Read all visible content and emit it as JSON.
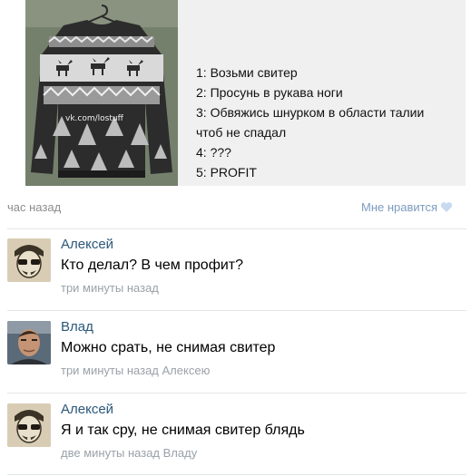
{
  "post": {
    "watermark": "vk.com/lostuff",
    "steps": [
      "1: Возьми свитер",
      "2: Просунь в рукава ноги",
      "3: Обвяжись шнурком в области талии",
      "чтоб не спадал",
      "4: ???",
      "5: PROFIT"
    ],
    "time": "час назад",
    "like_label": "Мне нравится",
    "like_icon": "heart-icon"
  },
  "comments": [
    {
      "author": "Алексей",
      "text": "Кто делал? В чем профит?",
      "time": "три минуты назад",
      "reply_to": "",
      "avatar_icon": "sketch-face-avatar"
    },
    {
      "author": "Влад",
      "text": "Можно срать, не снимая свитер",
      "time": "три минуты назад",
      "reply_to": "Алексею",
      "avatar_icon": "photo-avatar"
    },
    {
      "author": "Алексей",
      "text": "Я и так сру, не снимая свитер блядь",
      "time": "две минуты назад",
      "reply_to": "Владу",
      "avatar_icon": "sketch-face-avatar"
    }
  ],
  "colors": {
    "link": "#2b587a",
    "muted": "#8c8c8c",
    "like": "#7d9cbf",
    "separator": "#e4e6e9"
  }
}
